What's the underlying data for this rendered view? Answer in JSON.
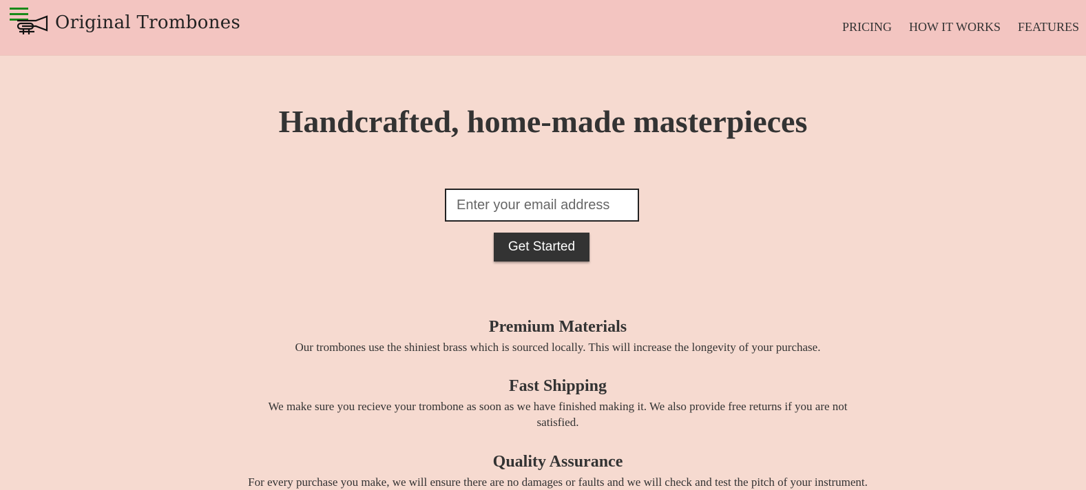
{
  "header": {
    "brand_name": "Original Trombones",
    "nav": [
      {
        "label": "PRICING"
      },
      {
        "label": "HOW IT WORKS"
      },
      {
        "label": "FEATURES"
      }
    ]
  },
  "hero": {
    "title": "Handcrafted, home-made masterpieces",
    "email_placeholder": "Enter your email address",
    "email_value": "",
    "cta_label": "Get Started"
  },
  "features": [
    {
      "title": "Premium Materials",
      "text": "Our trombones use the shiniest brass which is sourced locally. This will increase the longevity of your purchase."
    },
    {
      "title": "Fast Shipping",
      "text": "We make sure you recieve your trombone as soon as we have finished making it. We also provide free returns if you are not satisfied."
    },
    {
      "title": "Quality Assurance",
      "text": "For every purchase you make, we will ensure there are no damages or faults and we will check and test the pitch of your instrument."
    }
  ],
  "colors": {
    "page_background": "#f6dad0",
    "header_background": "#f3c5c1",
    "button_background": "#333333",
    "hamburger": "#198a19"
  },
  "icons": {
    "menu": "hamburger-icon",
    "logo": "trombone-icon"
  }
}
